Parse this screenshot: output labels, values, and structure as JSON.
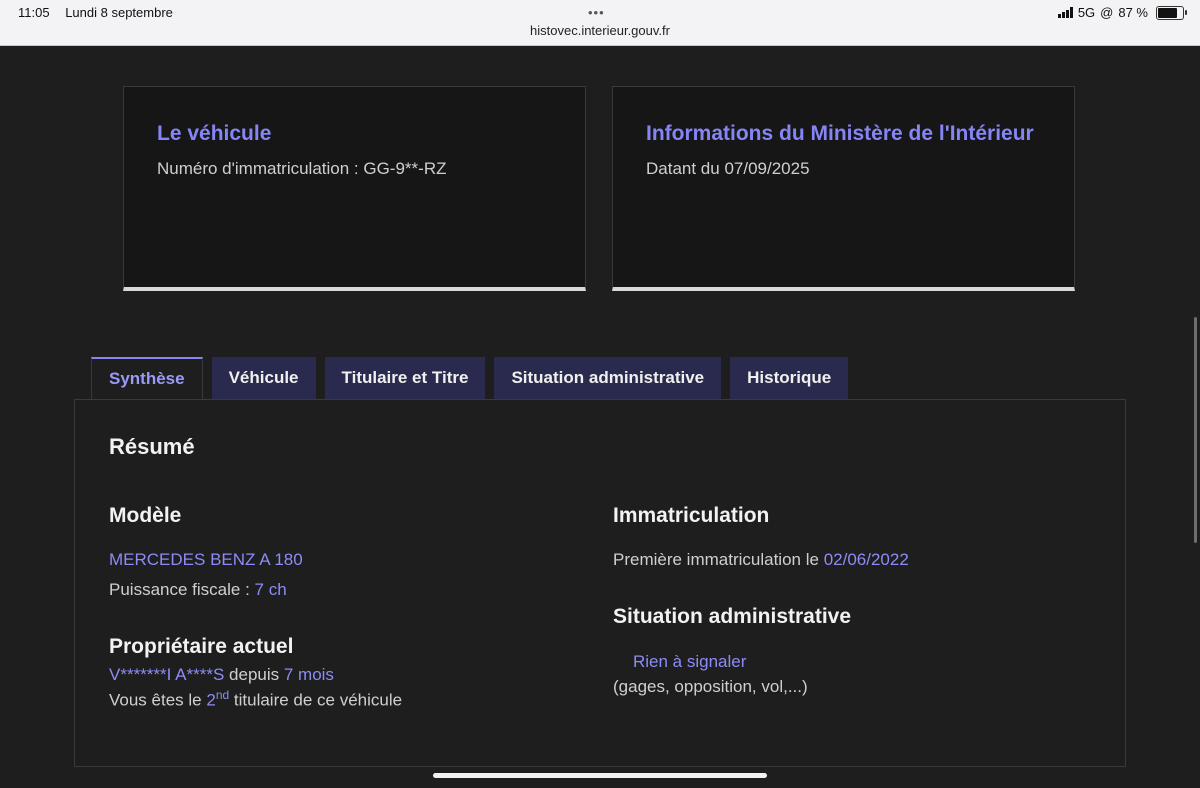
{
  "status_bar": {
    "time": "11:05",
    "date": "Lundi 8 septembre",
    "dots": "•••",
    "url": "histovec.interieur.gouv.fr",
    "network": "5G",
    "hotspot_glyph": "@",
    "battery_text": "87 %",
    "battery_level": 0.87
  },
  "cards": {
    "vehicle": {
      "title": "Le véhicule",
      "text": "Numéro d'immatriculation : GG-9**-RZ"
    },
    "ministry": {
      "title": "Informations du Ministère de l'Intérieur",
      "text": "Datant du 07/09/2025"
    }
  },
  "tabs": [
    {
      "label": "Synthèse",
      "active": true
    },
    {
      "label": "Véhicule",
      "active": false
    },
    {
      "label": "Titulaire et Titre",
      "active": false
    },
    {
      "label": "Situation administrative",
      "active": false
    },
    {
      "label": "Historique",
      "active": false
    }
  ],
  "summary": {
    "heading": "Résumé",
    "model": {
      "title": "Modèle",
      "name": "MERCEDES BENZ A 180",
      "power_label": "Puissance fiscale : ",
      "power_value": "7 ch"
    },
    "owner": {
      "title": "Propriétaire actuel",
      "name": "V*******I A****S",
      "since_label": " depuis ",
      "since_value": "7 mois",
      "rank_prefix": "Vous êtes le ",
      "rank_value": "2",
      "rank_sup": "nd",
      "rank_suffix": " titulaire de ce véhicule"
    },
    "registration": {
      "title": "Immatriculation",
      "label": "Première immatriculation le ",
      "date": "02/06/2022"
    },
    "admin": {
      "title": "Situation administrative",
      "status": "Rien à signaler",
      "details": "(gages, opposition, vol,...)"
    }
  },
  "colors": {
    "accent": "#8585f6",
    "background": "#1e1e1e",
    "tab_bg": "#2a2a4e"
  }
}
